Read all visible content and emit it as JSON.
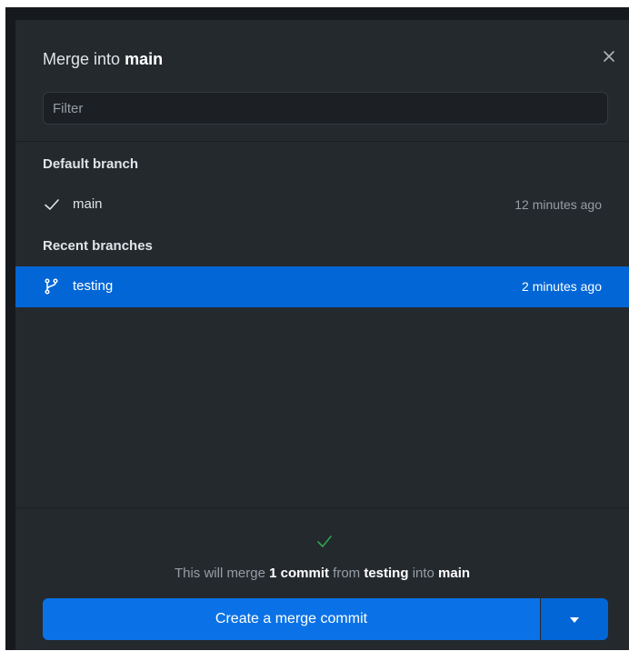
{
  "dialog": {
    "title_prefix": "Merge into",
    "title_branch": "main",
    "filter_placeholder": "Filter",
    "sections": {
      "default_header": "Default branch",
      "recent_header": "Recent branches"
    },
    "default_branches": [
      {
        "name": "main",
        "time": "12 minutes ago",
        "icon": "check-icon",
        "selected": false
      }
    ],
    "recent_branches": [
      {
        "name": "testing",
        "time": "2 minutes ago",
        "icon": "git-branch-icon",
        "selected": true
      }
    ],
    "footer": {
      "status_icon": "check-icon",
      "status_color": "#2ea44f",
      "summary": {
        "prefix": "This will merge",
        "count": "1 commit",
        "middle": "from",
        "source": "testing",
        "connector": "into",
        "target": "main"
      },
      "merge_button_label": "Create a merge commit"
    }
  },
  "colors": {
    "dialog_bg": "#24292e",
    "selected_row": "#0366d6",
    "button_primary": "#0a72e6"
  }
}
